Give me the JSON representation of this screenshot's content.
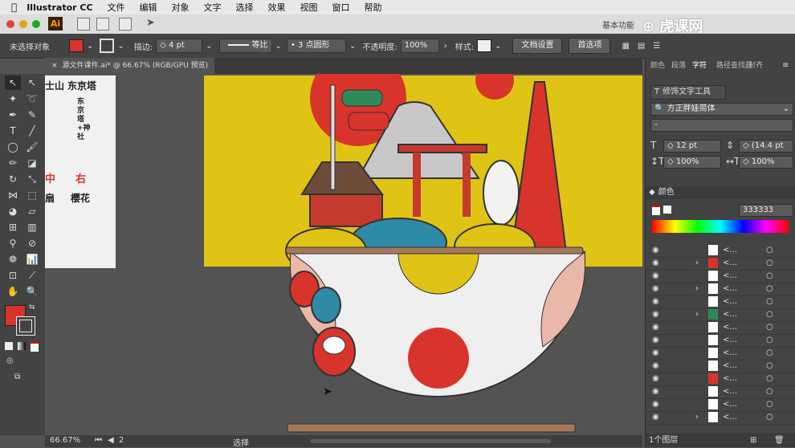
{
  "menubar": {
    "app": "Illustrator CC",
    "items": [
      "文件",
      "编辑",
      "对象",
      "文字",
      "选择",
      "效果",
      "视图",
      "窗口",
      "帮助"
    ],
    "workspace": "基本功能"
  },
  "options": {
    "no_selection": "未选择对象",
    "stroke_label": "描边:",
    "stroke_value": "4 pt",
    "stroke_profile": "等比",
    "brush": "3 点圆形",
    "opacity_label": "不透明度:",
    "opacity_value": "100%",
    "style_label": "样式:",
    "doc_setup": "文档设置",
    "prefs": "首选项"
  },
  "tab": {
    "title": "源文件课件.ai* @ 66.67% (RGB/GPU 预览)"
  },
  "left_art_texts": {
    "t1": "士山",
    "t2": "东京塔",
    "t3": "东京塔+神社",
    "t4": "中",
    "t5": "右",
    "t6": "扇",
    "t7": "樱花"
  },
  "panel": {
    "tabs": [
      "颜色",
      "段落",
      "字符",
      "路径查找器",
      "对齐"
    ],
    "touch_tool": "修饰文字工具",
    "font_family": "方正胖娃简体",
    "font_style": "-",
    "size": "12 pt",
    "leading": "(14.4 pt",
    "scale_v": "100%",
    "scale_h": "100%",
    "color_title": "颜色",
    "hex_label": "#",
    "hex": "333333",
    "layer_item_label": "<...",
    "layers_count": "1个图层"
  },
  "status": {
    "zoom": "66.67%",
    "page": "2",
    "tool": "选择"
  },
  "colors": {
    "fill": "#d9342b",
    "artboard": "#e0c415"
  }
}
